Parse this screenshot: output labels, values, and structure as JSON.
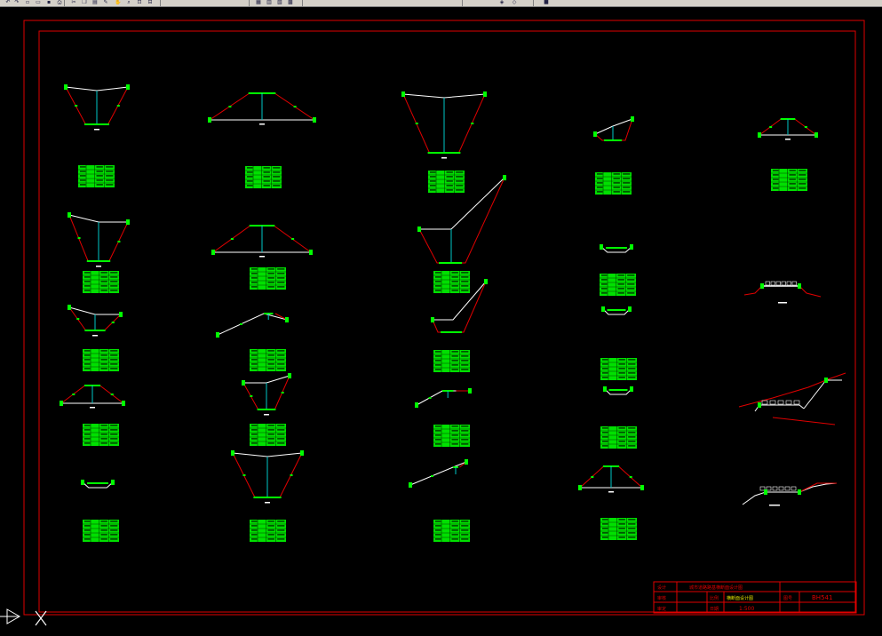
{
  "app": {
    "toolbar_buttons": [
      {
        "icon": "undo-icon",
        "glyph": "↶"
      },
      {
        "icon": "redo-icon",
        "glyph": "↷"
      },
      {
        "icon": "new-file-icon",
        "glyph": "▫"
      },
      {
        "icon": "open-icon",
        "glyph": "▭"
      },
      {
        "icon": "save-icon",
        "glyph": "▪"
      },
      {
        "icon": "print-icon",
        "glyph": "⎙"
      },
      {
        "icon": "cut-icon",
        "glyph": "✂"
      },
      {
        "icon": "copy-icon",
        "glyph": "❐"
      },
      {
        "icon": "paste-icon",
        "glyph": "▤"
      },
      {
        "icon": "match-properties-icon",
        "glyph": "✎"
      },
      {
        "icon": "pan-icon",
        "glyph": "✋"
      },
      {
        "icon": "zoom-realtime-icon",
        "glyph": "⌕"
      },
      {
        "icon": "zoom-window-icon",
        "glyph": "⊡"
      },
      {
        "icon": "zoom-previous-icon",
        "glyph": "⊟"
      },
      {
        "icon": "properties-icon",
        "glyph": "▦"
      },
      {
        "icon": "design-center-icon",
        "glyph": "▥"
      },
      {
        "icon": "tool-palettes-icon",
        "glyph": "▧"
      },
      {
        "icon": "calculator-icon",
        "glyph": "▩"
      },
      {
        "icon": "layer-icon",
        "glyph": "◈"
      },
      {
        "icon": "layer-state-icon",
        "glyph": "◇"
      },
      {
        "icon": "color-control-icon",
        "glyph": "■"
      }
    ]
  },
  "drawing": {
    "colors": {
      "background": "#000000",
      "border": "#e00000",
      "table_fill": "#00e000",
      "cross_section_line": "#ffffff",
      "slope_line": "#e00000",
      "center_line": "#00c8c8",
      "marker": "#00ff00"
    },
    "title_block": {
      "project_title": "城市道路路基横断面设计图",
      "label_design": "设计",
      "label_check": "审核",
      "label_drawing": "横断面设计图",
      "label_scale": "比例",
      "scale_value": "1:500",
      "label_sheet": "图号",
      "drawing_number": "BH541",
      "label_approve": "审定",
      "label_date": "日期"
    },
    "ucs_icon": "ucs-icon"
  }
}
